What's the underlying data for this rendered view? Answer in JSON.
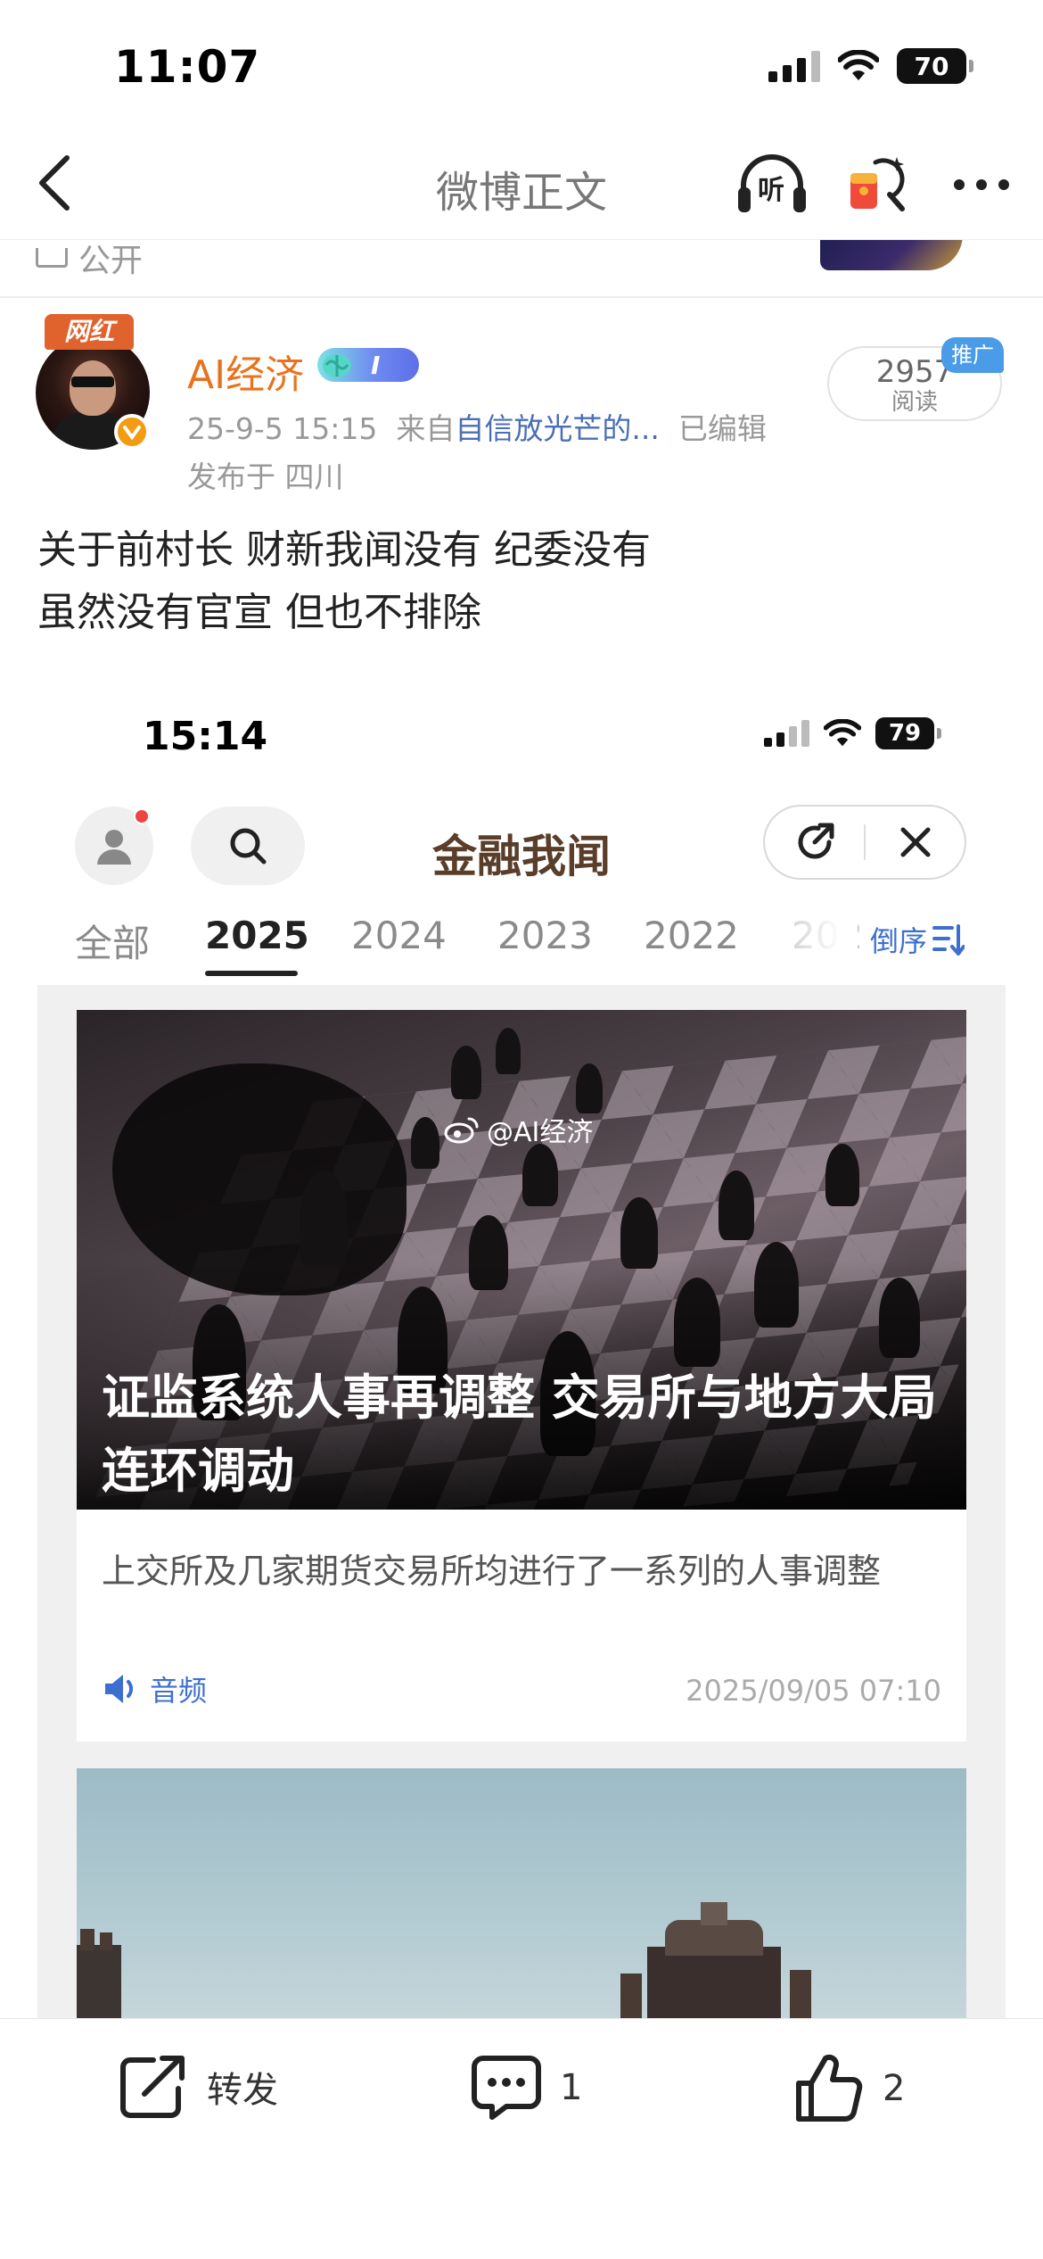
{
  "status_bar": {
    "time": "11:07",
    "battery": "70"
  },
  "nav": {
    "title": "微博正文",
    "listen_label": "听"
  },
  "prev_post": {
    "visibility": "公开"
  },
  "post": {
    "influencer_badge": "网红",
    "username": "AI经济",
    "level": "I",
    "time": "25-9-5 15:15",
    "source_prefix": "来自",
    "source": "自信放光芒的...",
    "edited": "已编辑",
    "location": "发布于 四川",
    "reads": "2957",
    "reads_label": "阅读",
    "promo_tag": "推广",
    "text_lines": [
      "关于前村长 财新我闻没有 纪委没有",
      "虽然没有官宣 但也不排除"
    ]
  },
  "embedded": {
    "status_time": "15:14",
    "battery": "79",
    "title": "金融我闻",
    "tabs": [
      "全部",
      "2025",
      "2024",
      "2023",
      "2022",
      "202"
    ],
    "active_tab": "2025",
    "sort_label": "倒序",
    "card": {
      "watermark": "@AI经济",
      "title": "证监系统人事再调整 交易所与地方大局连环调动",
      "description": "上交所及几家期货交易所均进行了一系列的人事调整",
      "audio_label": "音频",
      "date": "2025/09/05 07:10"
    }
  },
  "actions": {
    "repost_label": "转发",
    "comment_count": "1",
    "like_count": "2"
  },
  "colors": {
    "accent_blue": "#3d6fd0",
    "username_orange": "#e8731e",
    "verify_orange": "#f39c12"
  }
}
